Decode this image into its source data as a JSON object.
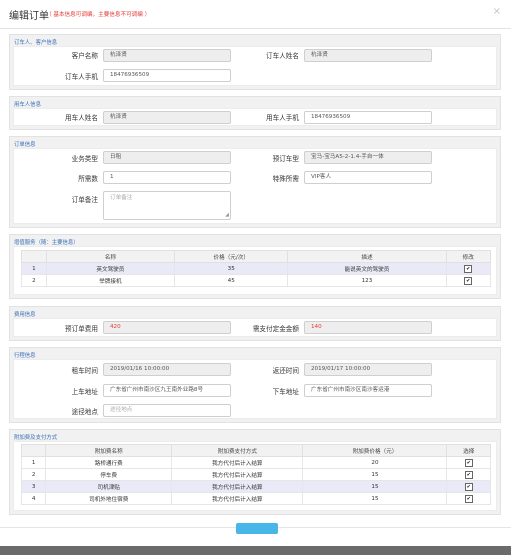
{
  "header": {
    "title": "编辑订单",
    "note": "（ 基本信息可调编，主要信息不可调编 ）",
    "close": "×"
  },
  "sections": {
    "orderer": {
      "title": "订车人、客户信息",
      "customer_name_label": "客户名称",
      "customer_name_value": "杭泽贤",
      "orderer_name_label": "订车人姓名",
      "orderer_name_value": "杭泽贤",
      "orderer_phone_label": "订车人手机",
      "orderer_phone_value": "18476936509"
    },
    "user": {
      "title": "用车人信息",
      "user_name_label": "用车人姓名",
      "user_name_value": "杭泽贤",
      "user_phone_label": "用车人手机",
      "user_phone_value": "18476936509"
    },
    "order": {
      "title": "订单信息",
      "business_type_label": "业务类型",
      "business_type_value": "日租",
      "car_model_label": "预订车型",
      "car_model_value": "宝马-宝马A5-2-1.4-手自一体",
      "car_count_label": "所需数",
      "car_count_value": "1",
      "special_label": "特殊所需",
      "special_value": "VIP客人",
      "remark_label": "订单备注",
      "remark_value": "订单备注"
    },
    "services": {
      "title": "增值服务（随：主要信息）",
      "columns": [
        "",
        "名称",
        "价格（元/次）",
        "描述",
        "修改"
      ],
      "rows": [
        {
          "no": "1",
          "name": "英文驾驶员",
          "price": "35",
          "desc": "能说英文的驾驶员",
          "checked": "✔"
        },
        {
          "no": "2",
          "name": "举牌接机",
          "price": "45",
          "desc": "123",
          "checked": "✔"
        }
      ]
    },
    "fee": {
      "title": "费用信息",
      "estimate_label": "预订单费用",
      "estimate_value": "420",
      "prepay_label": "需支付定金金额",
      "prepay_value": "140"
    },
    "trip": {
      "title": "行程信息",
      "pickup_time_label": "租车时间",
      "pickup_time_value": "2019/01/16 10:00:00",
      "return_time_label": "返还时间",
      "return_time_value": "2019/01/17 10:00:00",
      "pickup_addr_label": "上车地址",
      "pickup_addr_value": "广东省广州市南沙区九王南外业路8号",
      "dropoff_addr_label": "下车地址",
      "dropoff_addr_value": "广东省广州市南沙区南沙客运港",
      "via_label": "途径地点",
      "via_placeholder": "途径地点"
    },
    "extras": {
      "title": "附加费及支付方式",
      "columns": [
        "",
        "附加费名称",
        "附加费支付方式",
        "附加费价格（元）",
        "选择"
      ],
      "rows": [
        {
          "no": "1",
          "name": "路桥通行费",
          "method": "我方代付后计入结算",
          "price": "20",
          "checked": "✔"
        },
        {
          "no": "2",
          "name": "停车费",
          "method": "我方代付后计入结算",
          "price": "15",
          "checked": "✔"
        },
        {
          "no": "3",
          "name": "司机津贴",
          "method": "我方代付后计入结算",
          "price": "15",
          "checked": "✔"
        },
        {
          "no": "4",
          "name": "司机外地住宿费",
          "method": "我方代付后计入结算",
          "price": "15",
          "checked": "✔"
        }
      ]
    }
  },
  "footer": {
    "button_label": ""
  },
  "colors": {
    "section_title": "#3a6fb8",
    "alert_red": "#e53935",
    "button": "#48b6e6",
    "row_highlight": "#e9e9f7"
  }
}
